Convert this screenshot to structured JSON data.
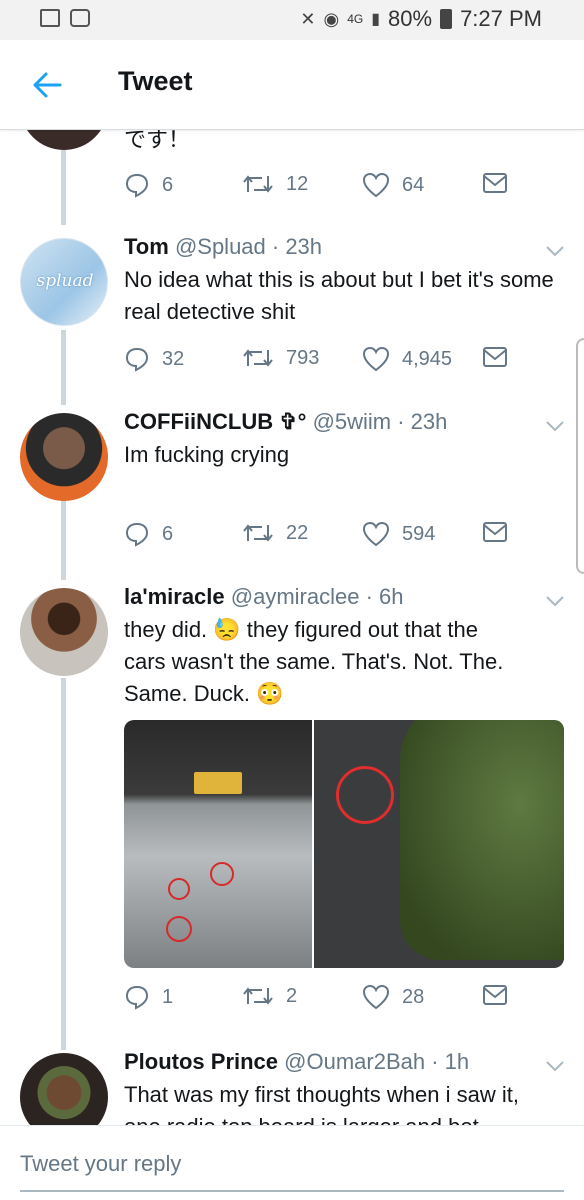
{
  "status_bar": {
    "network": "4G",
    "battery": "80%",
    "time": "7:27 PM"
  },
  "header": {
    "title": "Tweet"
  },
  "tweets": [
    {
      "text": "です！",
      "replies": "6",
      "retweets": "12",
      "likes": "64"
    },
    {
      "name": "Tom",
      "handle": "@Spluad · 23h",
      "avatar_text": "spluad",
      "text": "No idea what this is about but I bet it's some real detective shit",
      "replies": "32",
      "retweets": "793",
      "likes": "4,945"
    },
    {
      "name": "COFFiiNCLUB ✞°",
      "handle": "@5wiim · 23h",
      "text": "Im fucking crying",
      "replies": "6",
      "retweets": "22",
      "likes": "594"
    },
    {
      "name": "la'miracle",
      "handle": "@aymiraclee · 6h",
      "text_line1": "they did. 😓 they figured out that the",
      "text_line2": "cars wasn't the same. That's. Not. The.",
      "text_line3": "Same. Duck. 😳",
      "replies": "1",
      "retweets": "2",
      "likes": "28"
    },
    {
      "name": "Ploutos Prince",
      "handle": "@Oumar2Bah · 1h",
      "text_line1": "That was my first thoughts when i saw it,",
      "text_line2": "one radio top board is larger and bot"
    }
  ],
  "reply_bar": {
    "placeholder": "Tweet your reply"
  },
  "colors": {
    "accent": "#1da1f2",
    "text": "#14171a",
    "muted": "#657786",
    "thread_line": "#ccd6dd"
  }
}
